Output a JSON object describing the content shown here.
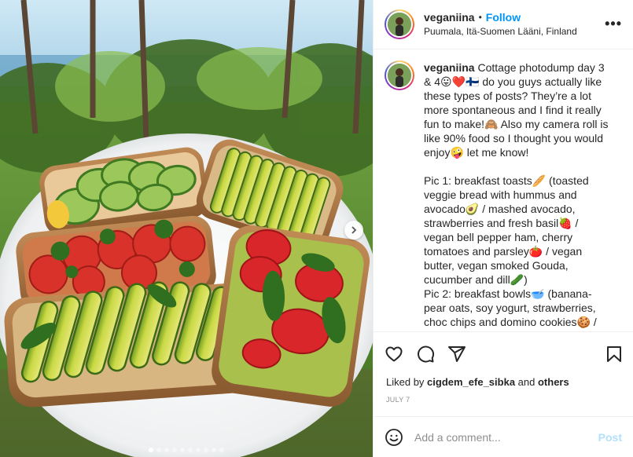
{
  "header": {
    "username": "veganiina",
    "separator": "•",
    "follow_label": "Follow",
    "location": "Puumala, Itä-Suomen Lääni, Finland",
    "more_label": "•••"
  },
  "caption": {
    "username": "veganiina",
    "text": " Cottage photodump day 3 & 4😛❤️🇫🇮 do you guys actually like these types of posts? They’re a lot more spontaneous and I find it really fun to make!🙈 Also my camera roll is like 90% food so I thought you would enjoy🤪 let me know!\n\nPic 1: breakfast toasts🥖 (toasted veggie bread with hummus and avocado🥑 / mashed avocado, strawberries and fresh basil🍓 / vegan bell pepper ham, cherry tomatoes and parsley🍅 / vegan butter, vegan smoked Gouda, cucumber and dill🥒)\nPic 2: breakfast bowls🥣 (banana-pear oats, soy yogurt, strawberries, choc chips and domino cookies🍪 / soy yogurt, banana, strawberries,"
  },
  "likes": {
    "prefix": "Liked by ",
    "user": "cigdem_efe_sibka",
    "middle": " and ",
    "others": "others"
  },
  "date": "JULY 7",
  "comment_box": {
    "placeholder": "Add a comment...",
    "post_label": "Post"
  },
  "carousel": {
    "total": 10,
    "current": 1
  },
  "colors": {
    "accent": "#0095f6",
    "post_disabled": "#b2dffc",
    "muted": "#8e8e8e",
    "border": "#efefef"
  },
  "icons": [
    "heart-icon",
    "comment-icon",
    "share-icon",
    "bookmark-icon",
    "emoji-icon",
    "chevron-right-icon",
    "more-icon"
  ]
}
